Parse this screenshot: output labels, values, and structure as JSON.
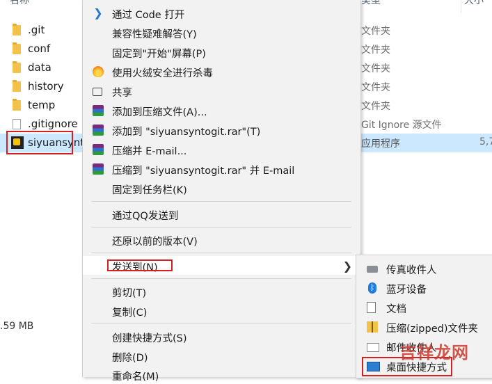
{
  "explorer": {
    "headers": {
      "name": "名称",
      "type": "类型",
      "size": "大小"
    },
    "files": [
      {
        "name": ".git",
        "type": "文件夹",
        "size": ""
      },
      {
        "name": "conf",
        "type": "文件夹",
        "size": ""
      },
      {
        "name": "data",
        "type": "文件夹",
        "size": ""
      },
      {
        "name": "history",
        "type": "文件夹",
        "size": ""
      },
      {
        "name": "temp",
        "type": "文件夹",
        "size": ""
      },
      {
        "name": ".gitignore",
        "type": "Git Ignore 源文件",
        "size": ""
      },
      {
        "name": "siyuansynto",
        "type": "应用程序",
        "size": "5,7"
      }
    ],
    "status_size": ".59 MB"
  },
  "context_menu": {
    "items": [
      {
        "label": "通过 Code 打开",
        "icon": "vscode-icon"
      },
      {
        "label": "兼容性疑难解答(Y)",
        "icon": ""
      },
      {
        "label": "固定到\"开始\"屏幕(P)",
        "icon": ""
      },
      {
        "label": "使用火绒安全进行杀毒",
        "icon": "huorong-icon"
      },
      {
        "label": "共享",
        "icon": "share-icon"
      },
      {
        "label": "添加到压缩文件(A)...",
        "icon": "winrar-icon"
      },
      {
        "label": "添加到 \"siyuansyntogit.rar\"(T)",
        "icon": "winrar-icon"
      },
      {
        "label": "压缩并 E-mail...",
        "icon": "winrar-icon"
      },
      {
        "label": "压缩到 \"siyuansyntogit.rar\" 并 E-mail",
        "icon": "winrar-icon"
      },
      {
        "label": "固定到任务栏(K)",
        "icon": ""
      },
      {
        "label": "通过QQ发送到",
        "icon": ""
      },
      {
        "label": "还原以前的版本(V)",
        "icon": ""
      },
      {
        "label": "发送到(N)",
        "icon": ""
      },
      {
        "label": "剪切(T)",
        "icon": ""
      },
      {
        "label": "复制(C)",
        "icon": ""
      },
      {
        "label": "创建快捷方式(S)",
        "icon": ""
      },
      {
        "label": "删除(D)",
        "icon": ""
      },
      {
        "label": "重命名(M)",
        "icon": ""
      }
    ]
  },
  "send_to_submenu": {
    "items": [
      {
        "label": "传真收件人",
        "icon": "fax-icon"
      },
      {
        "label": "蓝牙设备",
        "icon": "bluetooth-icon"
      },
      {
        "label": "文档",
        "icon": "document-icon"
      },
      {
        "label": "压缩(zipped)文件夹",
        "icon": "zip-folder-icon"
      },
      {
        "label": "邮件收件人",
        "icon": "mail-icon"
      },
      {
        "label": "桌面快捷方式",
        "icon": "desktop-icon"
      }
    ]
  },
  "watermark": "吉祥龙网",
  "colors": {
    "selection": "#cce8ff",
    "highlight_box": "#d42020",
    "menu_bg": "#f2f2f2"
  }
}
